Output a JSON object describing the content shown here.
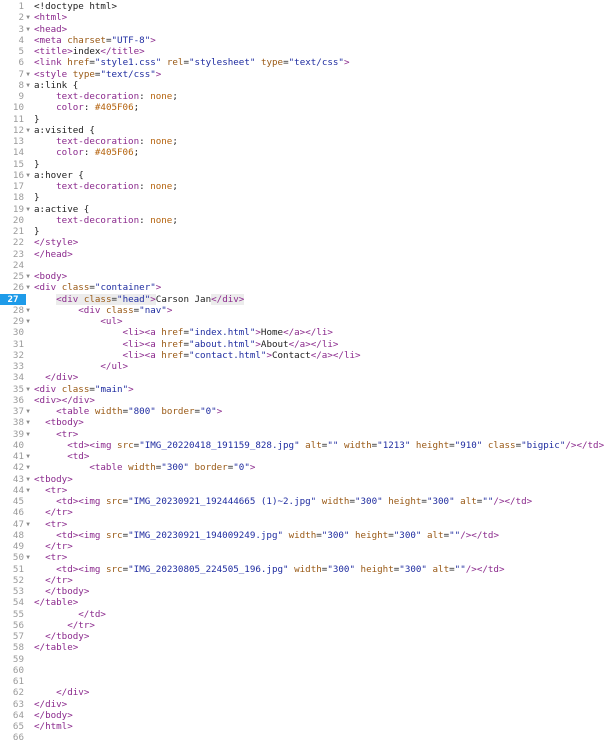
{
  "editor": {
    "current_line": 27,
    "fold_icon": "triangle-down",
    "lines": [
      {
        "n": 1,
        "fold": false,
        "mode": "plain",
        "text": "<!doctype html>"
      },
      {
        "n": 2,
        "fold": true,
        "mode": "html",
        "text": "<html>"
      },
      {
        "n": 3,
        "fold": true,
        "mode": "html",
        "text": "<head>"
      },
      {
        "n": 4,
        "fold": false,
        "mode": "html",
        "text": "<meta charset=\"UTF-8\">"
      },
      {
        "n": 5,
        "fold": false,
        "mode": "html",
        "text": "<title>index</title>"
      },
      {
        "n": 6,
        "fold": false,
        "mode": "html",
        "text": "<link href=\"style1.css\" rel=\"stylesheet\" type=\"text/css\">"
      },
      {
        "n": 7,
        "fold": true,
        "mode": "html",
        "text": "<style type=\"text/css\">"
      },
      {
        "n": 8,
        "fold": true,
        "mode": "plain",
        "text": "a:link {"
      },
      {
        "n": 9,
        "fold": false,
        "mode": "css",
        "text": "    text-decoration: none;"
      },
      {
        "n": 10,
        "fold": false,
        "mode": "css",
        "text": "    color: #405F06;"
      },
      {
        "n": 11,
        "fold": false,
        "mode": "plain",
        "text": "}"
      },
      {
        "n": 12,
        "fold": true,
        "mode": "plain",
        "text": "a:visited {"
      },
      {
        "n": 13,
        "fold": false,
        "mode": "css",
        "text": "    text-decoration: none;"
      },
      {
        "n": 14,
        "fold": false,
        "mode": "css",
        "text": "    color: #405F06;"
      },
      {
        "n": 15,
        "fold": false,
        "mode": "plain",
        "text": "}"
      },
      {
        "n": 16,
        "fold": true,
        "mode": "plain",
        "text": "a:hover {"
      },
      {
        "n": 17,
        "fold": false,
        "mode": "css",
        "text": "    text-decoration: none;"
      },
      {
        "n": 18,
        "fold": false,
        "mode": "plain",
        "text": "}"
      },
      {
        "n": 19,
        "fold": true,
        "mode": "plain",
        "text": "a:active {"
      },
      {
        "n": 20,
        "fold": false,
        "mode": "css",
        "text": "    text-decoration: none;"
      },
      {
        "n": 21,
        "fold": false,
        "mode": "plain",
        "text": "}"
      },
      {
        "n": 22,
        "fold": false,
        "mode": "html",
        "text": "</style>"
      },
      {
        "n": 23,
        "fold": false,
        "mode": "html",
        "text": "</head>"
      },
      {
        "n": 24,
        "fold": false,
        "mode": "html",
        "text": ""
      },
      {
        "n": 25,
        "fold": true,
        "mode": "html",
        "text": "<body>"
      },
      {
        "n": 26,
        "fold": true,
        "mode": "html",
        "text": "<div class=\"container\">"
      },
      {
        "n": 27,
        "fold": false,
        "mode": "html",
        "text": "    <div class=\"head\">Carson Jan</div>"
      },
      {
        "n": 28,
        "fold": true,
        "mode": "html",
        "text": "        <div class=\"nav\">"
      },
      {
        "n": 29,
        "fold": true,
        "mode": "html",
        "text": "            <ul>"
      },
      {
        "n": 30,
        "fold": false,
        "mode": "html",
        "text": "                <li><a href=\"index.html\">Home</a></li>"
      },
      {
        "n": 31,
        "fold": false,
        "mode": "html",
        "text": "                <li><a href=\"about.html\">About</a></li>"
      },
      {
        "n": 32,
        "fold": false,
        "mode": "html",
        "text": "                <li><a href=\"contact.html\">Contact</a></li>"
      },
      {
        "n": 33,
        "fold": false,
        "mode": "html",
        "text": "            </ul>"
      },
      {
        "n": 34,
        "fold": false,
        "mode": "html",
        "text": "  </div>"
      },
      {
        "n": 35,
        "fold": true,
        "mode": "html",
        "text": "<div class=\"main\">"
      },
      {
        "n": 36,
        "fold": false,
        "mode": "html",
        "text": "<div></div>"
      },
      {
        "n": 37,
        "fold": true,
        "mode": "html",
        "text": "    <table width=\"800\" border=\"0\">"
      },
      {
        "n": 38,
        "fold": true,
        "mode": "html",
        "text": "  <tbody>"
      },
      {
        "n": 39,
        "fold": true,
        "mode": "html",
        "text": "    <tr>"
      },
      {
        "n": 40,
        "fold": false,
        "mode": "html",
        "text": "      <td><img src=\"IMG_20220418_191159_828.jpg\" alt=\"\" width=\"1213\" height=\"910\" class=\"bigpic\"/></td>"
      },
      {
        "n": 41,
        "fold": true,
        "mode": "html",
        "text": "      <td>"
      },
      {
        "n": 42,
        "fold": true,
        "mode": "html",
        "text": "          <table width=\"300\" border=\"0\">"
      },
      {
        "n": 43,
        "fold": true,
        "mode": "html",
        "text": "<tbody>"
      },
      {
        "n": 44,
        "fold": true,
        "mode": "html",
        "text": "  <tr>"
      },
      {
        "n": 45,
        "fold": false,
        "mode": "html",
        "text": "    <td><img src=\"IMG_20230921_192444665 (1)~2.jpg\" width=\"300\" height=\"300\" alt=\"\"/></td>"
      },
      {
        "n": 46,
        "fold": false,
        "mode": "html",
        "text": "  </tr>"
      },
      {
        "n": 47,
        "fold": true,
        "mode": "html",
        "text": "  <tr>"
      },
      {
        "n": 48,
        "fold": false,
        "mode": "html",
        "text": "    <td><img src=\"IMG_20230921_194009249.jpg\" width=\"300\" height=\"300\" alt=\"\"/></td>"
      },
      {
        "n": 49,
        "fold": false,
        "mode": "html",
        "text": "  </tr>"
      },
      {
        "n": 50,
        "fold": true,
        "mode": "html",
        "text": "  <tr>"
      },
      {
        "n": 51,
        "fold": false,
        "mode": "html",
        "text": "    <td><img src=\"IMG_20230805_224505_196.jpg\" width=\"300\" height=\"300\" alt=\"\"/></td>"
      },
      {
        "n": 52,
        "fold": false,
        "mode": "html",
        "text": "  </tr>"
      },
      {
        "n": 53,
        "fold": false,
        "mode": "html",
        "text": "  </tbody>"
      },
      {
        "n": 54,
        "fold": false,
        "mode": "html",
        "text": "</table>"
      },
      {
        "n": 55,
        "fold": false,
        "mode": "html",
        "text": "        </td>"
      },
      {
        "n": 56,
        "fold": false,
        "mode": "html",
        "text": "      </tr>"
      },
      {
        "n": 57,
        "fold": false,
        "mode": "html",
        "text": "  </tbody>"
      },
      {
        "n": 58,
        "fold": false,
        "mode": "html",
        "text": "</table>"
      },
      {
        "n": 59,
        "fold": false,
        "mode": "html",
        "text": ""
      },
      {
        "n": 60,
        "fold": false,
        "mode": "html",
        "text": ""
      },
      {
        "n": 61,
        "fold": false,
        "mode": "html",
        "text": ""
      },
      {
        "n": 62,
        "fold": false,
        "mode": "html",
        "text": "    </div>"
      },
      {
        "n": 63,
        "fold": false,
        "mode": "html",
        "text": "</div>"
      },
      {
        "n": 64,
        "fold": false,
        "mode": "html",
        "text": "</body>"
      },
      {
        "n": 65,
        "fold": false,
        "mode": "html",
        "text": "</html>"
      },
      {
        "n": 66,
        "fold": false,
        "mode": "html",
        "text": ""
      }
    ]
  }
}
